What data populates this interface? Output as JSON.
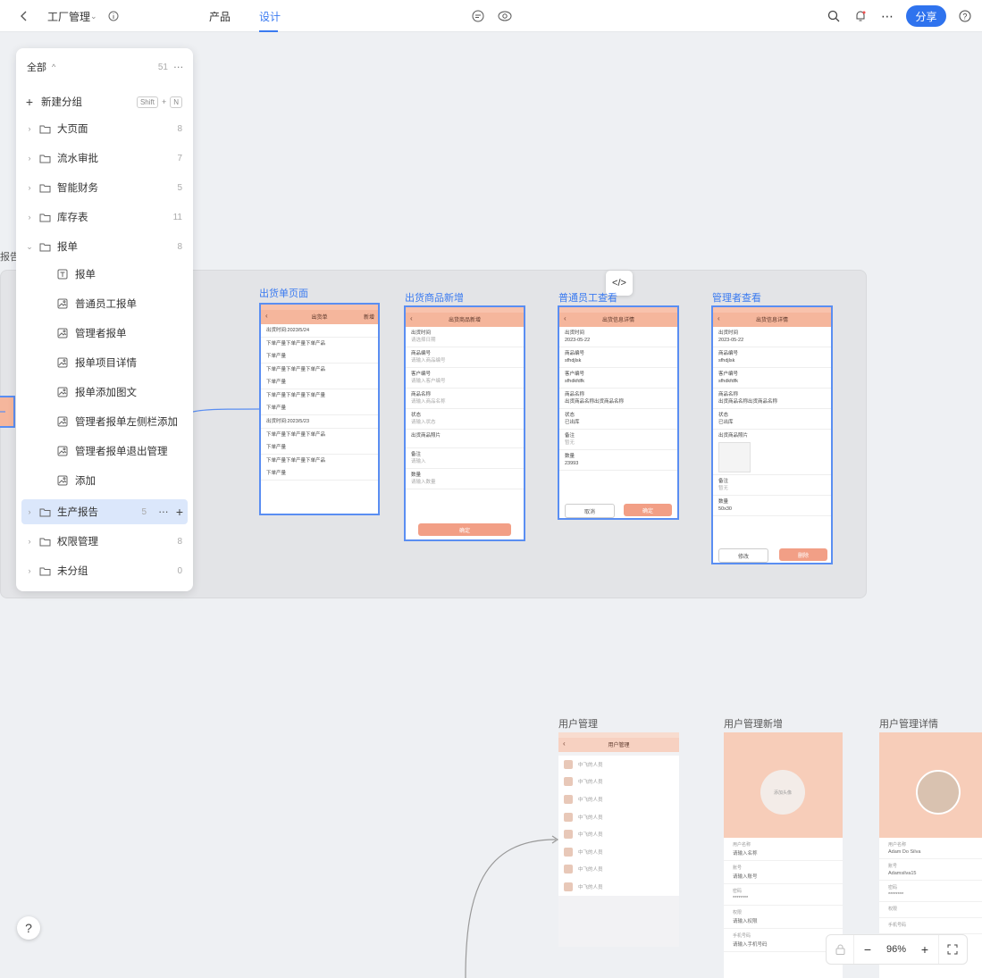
{
  "topbar": {
    "back": "<",
    "project_name": "工厂管理",
    "tabs": [
      "产品",
      "设计"
    ],
    "share": "分享"
  },
  "panel": {
    "header_label": "全部",
    "header_count": "51",
    "new_group_label": "新建分组",
    "shortcut_shift": "Shift",
    "shortcut_plus": "+",
    "shortcut_key": "N",
    "groups": [
      {
        "label": "大页面",
        "count": "8"
      },
      {
        "label": "流水审批",
        "count": "7"
      },
      {
        "label": "智能财务",
        "count": "5"
      },
      {
        "label": "库存表",
        "count": "11"
      },
      {
        "label": "报单",
        "count": "8"
      }
    ],
    "children": [
      {
        "label": "报单",
        "icon": "text-page-icon"
      },
      {
        "label": "普通员工报单",
        "icon": "image-page-icon"
      },
      {
        "label": "管理者报单",
        "icon": "image-page-icon"
      },
      {
        "label": "报单项目详情",
        "icon": "image-page-icon"
      },
      {
        "label": "报单添加图文",
        "icon": "image-page-icon"
      },
      {
        "label": "管理者报单左侧栏添加",
        "icon": "image-page-icon"
      },
      {
        "label": "管理者报单退出管理",
        "icon": "image-page-icon"
      },
      {
        "label": "添加",
        "icon": "image-page-icon"
      }
    ],
    "selected_group": {
      "label": "生产报告",
      "count": "5"
    },
    "after_groups": [
      {
        "label": "权限管理",
        "count": "8"
      },
      {
        "label": "未分组",
        "count": "0"
      }
    ]
  },
  "canvas": {
    "left_cut_label": "报告",
    "frames": [
      {
        "title": "出货单页面",
        "nav": "出货单",
        "nav_right": "新增",
        "rows": [
          "出货时间:2023/5/24",
          "下单产量下单产量下单产品",
          "下单产量",
          "下单产量下单产量下单产品",
          "下单产量",
          "下单产量下单产量下单产量",
          "下单产量",
          "出货时间:2023/5/23",
          "下单产量下单产量下单产品",
          "下单产量",
          "下单产量下单产量下单产品",
          "下单产量"
        ]
      },
      {
        "title": "出货商品新增",
        "nav": "出货商品新增",
        "rows": [
          "出货时间",
          "请选择日期",
          "商品编号",
          "请输入商品编号",
          "客户编号",
          "请输入客户编号",
          "商品名称",
          "请输入商品名称",
          "状态",
          "请输入状态",
          "出货商品照片",
          "备注",
          "请输入",
          "数量",
          "请输入数量"
        ],
        "button": "确定"
      },
      {
        "title": "普通员工查看",
        "nav": "出货信息详情",
        "rows": [
          "出货时间",
          "2023-05-22",
          "商品编号",
          "sfhdjlsk",
          "客户编号",
          "sfhdkfdfk",
          "商品名称",
          "出货商品名称出货商品名称",
          "状态",
          "已出库",
          "备注",
          "暂无",
          "数量",
          "23993"
        ],
        "buttons": [
          "取消",
          "确定"
        ]
      },
      {
        "title": "管理者查看",
        "nav": "出货信息详情",
        "rows": [
          "出货时间",
          "2023-05-22",
          "商品编号",
          "sfhdjlsk",
          "客户编号",
          "sfhdkfdfk",
          "商品名称",
          "出货商品名称出货商品名称",
          "状态",
          "已出库",
          "出货商品照片",
          "备注",
          "暂无",
          "数量",
          "50x30"
        ],
        "buttons": [
          "修改",
          "删除"
        ]
      },
      {
        "title": "用户管理",
        "nav": "用户管理",
        "items": [
          "中飞的人员",
          "中飞的人员",
          "中飞的人员",
          "中飞的人员",
          "中飞的人员",
          "中飞的人员",
          "中飞的人员",
          "中飞的人员"
        ]
      },
      {
        "title": "用户管理新增",
        "avatar_text": "添加头像",
        "fields": [
          "用户名称",
          "请输入名称",
          "账号",
          "请输入账号",
          "密码",
          "********",
          "权限",
          "请输入权限",
          "手机号码",
          "请输入手机号码"
        ]
      },
      {
        "title": "用户管理详情",
        "fields": [
          "用户名称",
          "Adam Do Silva",
          "账号",
          "Adamsilva15",
          "密码",
          "********",
          "权限",
          "",
          "手机号码",
          ""
        ]
      }
    ]
  },
  "zoom": {
    "minus": "−",
    "value": "96%",
    "plus": "+"
  },
  "help": "?",
  "code_btn": "</>"
}
